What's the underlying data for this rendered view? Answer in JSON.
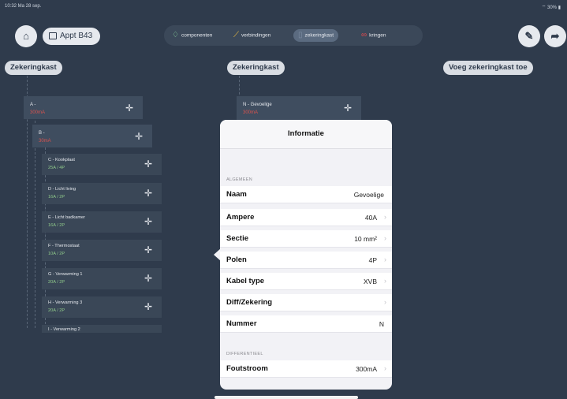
{
  "status": {
    "time": "10:32 Ma 28 sep.",
    "battery": "30%"
  },
  "header": {
    "home_icon": "home-icon",
    "apartment_label": "Appt B43",
    "tabs": [
      {
        "icon": "bulb-icon",
        "label": "componenten"
      },
      {
        "icon": "cable-icon",
        "label": "verbindingen"
      },
      {
        "icon": "fusebox-icon",
        "label": "zekeringkast"
      },
      {
        "icon": "loop-icon",
        "label": "kringen"
      }
    ],
    "edit_icon": "pencil-icon",
    "share_icon": "share-arrow-icon"
  },
  "columns": {
    "left": "Zekeringkast",
    "middle": "Zekeringkast",
    "add": "Voeg zekeringkast toe"
  },
  "tree": {
    "groupA": {
      "name": "A -",
      "sub": "300mA"
    },
    "groupB": {
      "name": "B -",
      "sub": "30mA"
    },
    "fuses": [
      {
        "name": "C - Kookplaat",
        "sub": "25A / 4P"
      },
      {
        "name": "D - Licht living",
        "sub": "16A / 2P"
      },
      {
        "name": "E - Licht badkamer",
        "sub": "16A / 2P"
      },
      {
        "name": "F - Thermostaat",
        "sub": "10A / 2P"
      },
      {
        "name": "G - Verwarming 1",
        "sub": "20A / 2P"
      },
      {
        "name": "H - Verwarming 3",
        "sub": "20A / 2P"
      },
      {
        "name": "I - Verwarming 2",
        "sub": ""
      }
    ],
    "groupN": {
      "name": "N - Gevoelige",
      "sub": "300mA"
    }
  },
  "popover": {
    "title": "Informatie",
    "section_general": "ALGEMEEN",
    "rows": [
      {
        "label": "Naam",
        "value": "Gevoelige"
      },
      {
        "label": "Ampere",
        "value": "40A"
      },
      {
        "label": "Sectie",
        "value": "10 mm²"
      },
      {
        "label": "Polen",
        "value": "4P"
      },
      {
        "label": "Kabel type",
        "value": "XVB"
      },
      {
        "label": "Diff/Zekering",
        "value": ""
      },
      {
        "label": "Nummer",
        "value": "N"
      }
    ],
    "section_diff": "DIFFERENTIEEL",
    "diff_rows": [
      {
        "label": "Foutstroom",
        "value": "300mA"
      }
    ]
  },
  "colors": {
    "background": "#2f3b4c",
    "red_text": "#d9534f",
    "green_text": "#8fc98a",
    "loop_icon": "#e5484d",
    "bulb_icon": "#8fe0a0",
    "cable_icon": "#f0c040"
  }
}
